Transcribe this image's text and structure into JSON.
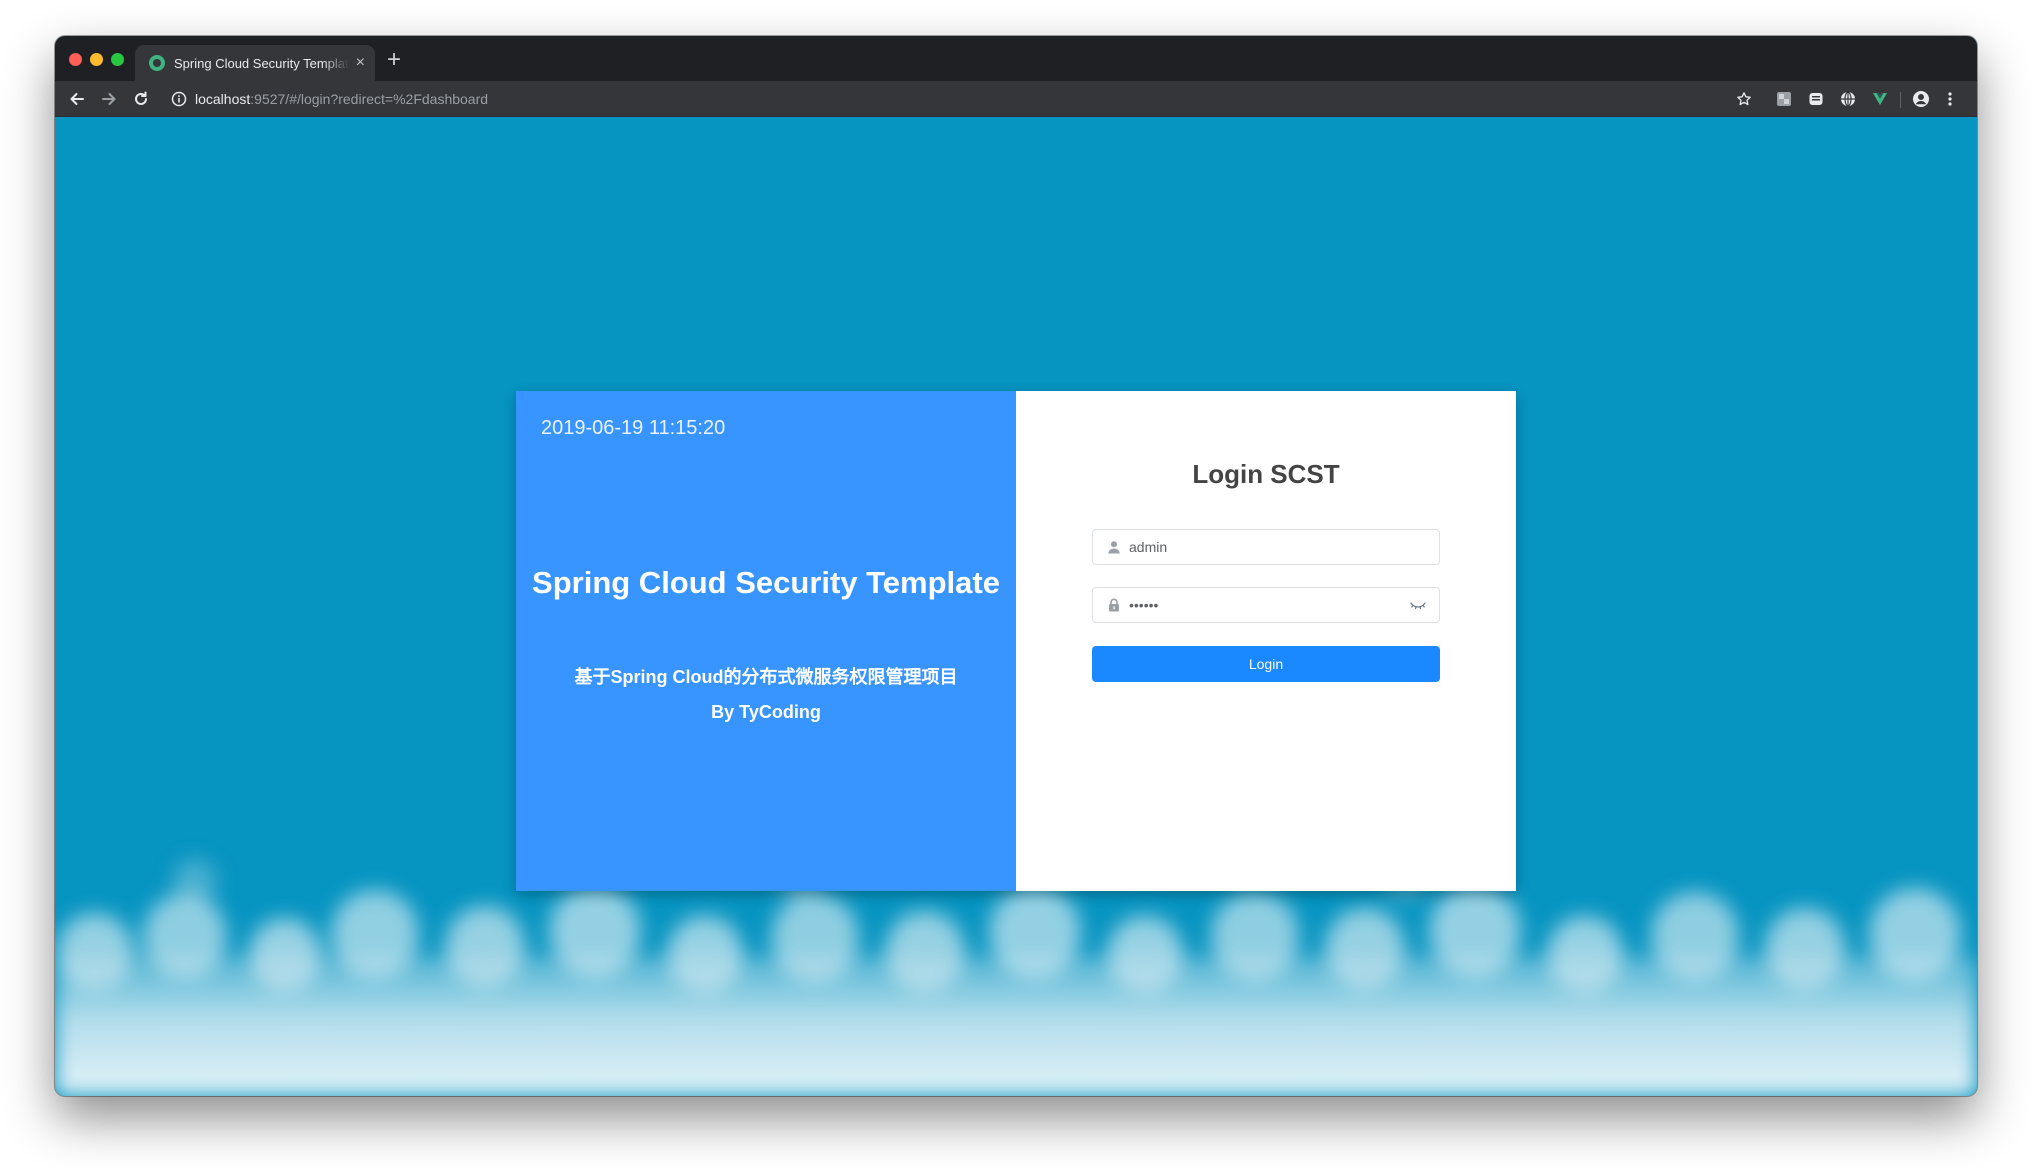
{
  "browser": {
    "tab_title": "Spring Cloud Security Template",
    "tab_close": "×",
    "new_tab": "+",
    "url_host": "localhost",
    "url_rest": ":9527/#/login?redirect=%2Fdashboard",
    "extensions": [
      "star-icon",
      "extension-icon-1",
      "extension-icon-2",
      "extension-icon-3",
      "vue-devtools-icon",
      "profile-icon",
      "menu-icon"
    ]
  },
  "login_panel": {
    "datetime": "2019-06-19 11:15:20",
    "project_title": "Spring Cloud Security Template",
    "project_subtitle": "基于Spring Cloud的分布式微服务权限管理项目",
    "project_author": "By TyCoding"
  },
  "login_form": {
    "heading": "Login SCST",
    "username_value": "admin",
    "password_value": "123456",
    "login_label": "Login"
  },
  "colors": {
    "page_background": "#0694c1",
    "panel_left": "#3894ff",
    "login_button": "#1a89ff"
  }
}
